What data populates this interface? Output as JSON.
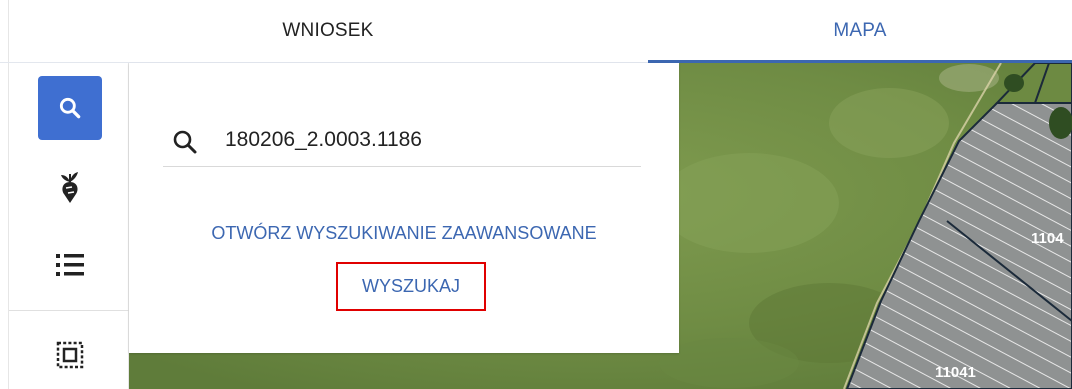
{
  "tabs": [
    {
      "label": "WNIOSEK",
      "active": false
    },
    {
      "label": "MAPA",
      "active": true
    }
  ],
  "sidebar": {
    "items": [
      {
        "icon": "search-icon",
        "active": true
      },
      {
        "icon": "beet-icon",
        "active": false
      },
      {
        "icon": "list-icon",
        "active": false
      },
      {
        "icon": "select-area-icon",
        "active": false
      }
    ]
  },
  "search": {
    "value": "180206_2.0003.1186",
    "advanced_label": "OTWÓRZ WYSZUKIWANIE ZAAWANSOWANE",
    "submit_label": "WYSZUKAJ"
  },
  "map": {
    "parcels": [
      {
        "label": "1104",
        "note": "partially visible"
      },
      {
        "label": "11041"
      }
    ]
  },
  "colors": {
    "accent": "#3c67b1",
    "active_button": "#3f6fd1",
    "highlight_border": "#e00000"
  }
}
